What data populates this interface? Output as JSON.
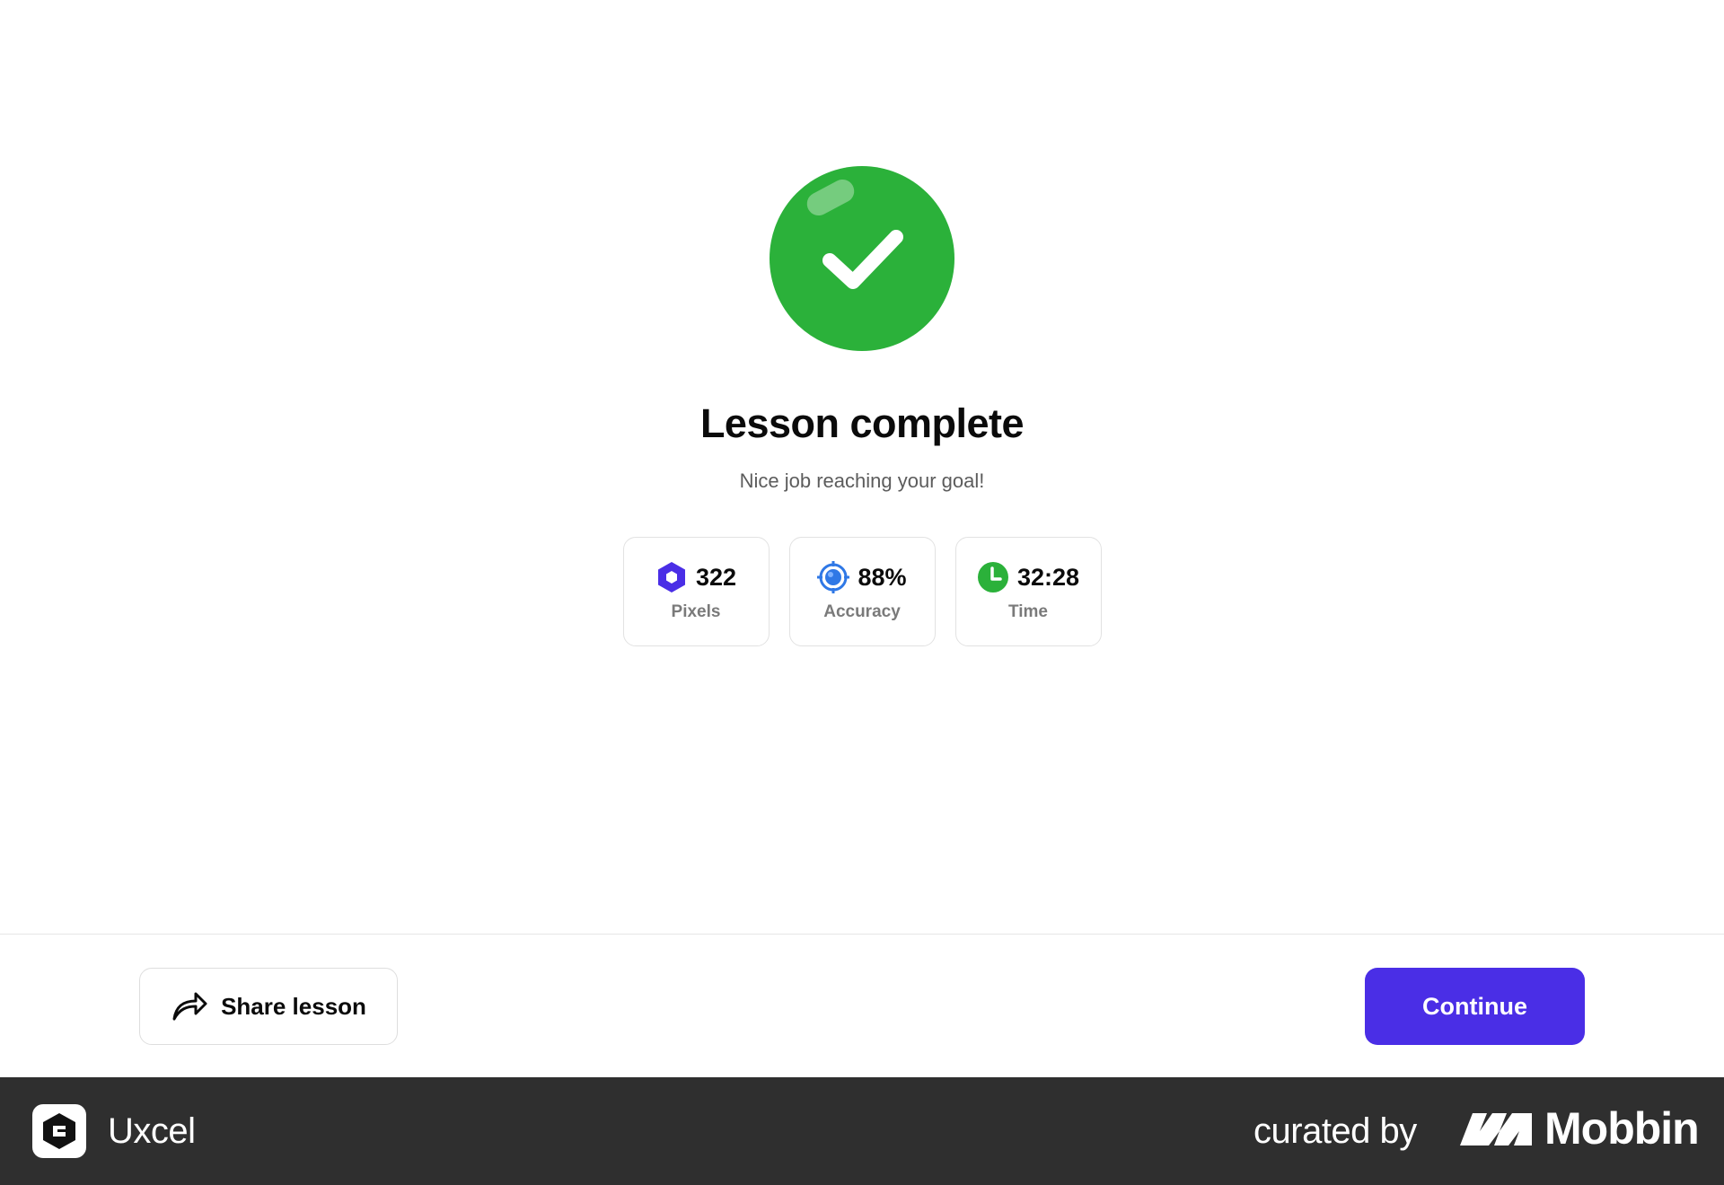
{
  "lesson": {
    "title": "Lesson complete",
    "subtitle": "Nice job reaching your goal!"
  },
  "stats": [
    {
      "value": "322",
      "label": "Pixels",
      "icon": "pixel-hexagon-icon",
      "color": "#4a2ee6"
    },
    {
      "value": "88%",
      "label": "Accuracy",
      "icon": "target-icon",
      "color": "#2f78e6"
    },
    {
      "value": "32:28",
      "label": "Time",
      "icon": "clock-icon",
      "color": "#2bb13a"
    }
  ],
  "actions": {
    "share_label": "Share lesson",
    "continue_label": "Continue"
  },
  "footer": {
    "app_name": "Uxcel",
    "curated_by": "curated by",
    "brand": "Mobbin"
  },
  "colors": {
    "success": "#2bb13a",
    "primary": "#4a2ee6",
    "footer_bg": "#2f2f2f"
  }
}
